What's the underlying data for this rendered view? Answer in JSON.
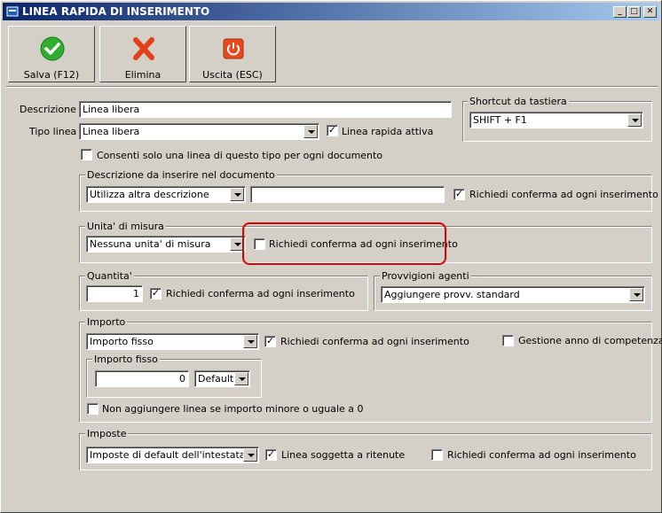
{
  "window": {
    "title": "LINEA RAPIDA DI INSERIMENTO",
    "controls": [
      "_",
      "□",
      "✕"
    ]
  },
  "toolbar": {
    "save_label": "Salva (F12)",
    "delete_label": "Elimina",
    "exit_label": "Uscita (ESC)"
  },
  "form": {
    "descrizione_label": "Descrizione :",
    "descrizione_value": "Linea libera",
    "tipo_label": "Tipo linea :",
    "tipo_value": "Linea libera",
    "linea_attiva_label": "Linea rapida attiva",
    "consenti_label": "Consenti solo una linea di questo tipo per ogni documento"
  },
  "shortcut": {
    "title": "Shortcut da tastiera",
    "value": "SHIFT + F1"
  },
  "descrizione_doc": {
    "title": "Descrizione da inserire nel documento",
    "combo_value": "Utilizza altra descrizione",
    "text_value": "",
    "conferma_label": "Richiedi conferma ad ogni inserimento"
  },
  "unita": {
    "title": "Unita' di misura",
    "combo_value": "Nessuna unita' di misura",
    "conferma_label": "Richiedi conferma ad ogni inserimento"
  },
  "quantita": {
    "title": "Quantita'",
    "value": "1",
    "conferma_label": "Richiedi conferma ad ogni inserimento"
  },
  "provvigioni": {
    "title": "Provvigioni agenti",
    "combo_value": "Aggiungere provv. standard"
  },
  "importo": {
    "title": "Importo",
    "combo_value": "Importo fisso",
    "conferma_label": "Richiedi conferma ad ogni inserimento",
    "gestione_label": "Gestione anno di competenza",
    "fisso_title": "Importo fisso",
    "fisso_value": "0",
    "fisso_combo": "Default",
    "non_aggiungere_label": "Non aggiungere linea se importo minore o uguale a 0"
  },
  "imposte": {
    "title": "Imposte",
    "combo_value": "Imposte di default dell'intestatario",
    "ritenute_label": "Linea soggetta a ritenute",
    "conferma_label": "Richiedi conferma ad ogni inserimento"
  },
  "checks": {
    "checked_mark": "✓"
  },
  "colors": {
    "titlebar_start": "#0a246a",
    "titlebar_end": "#a6caf0",
    "highlight": "#e00000",
    "face": "#d4d0c8"
  }
}
